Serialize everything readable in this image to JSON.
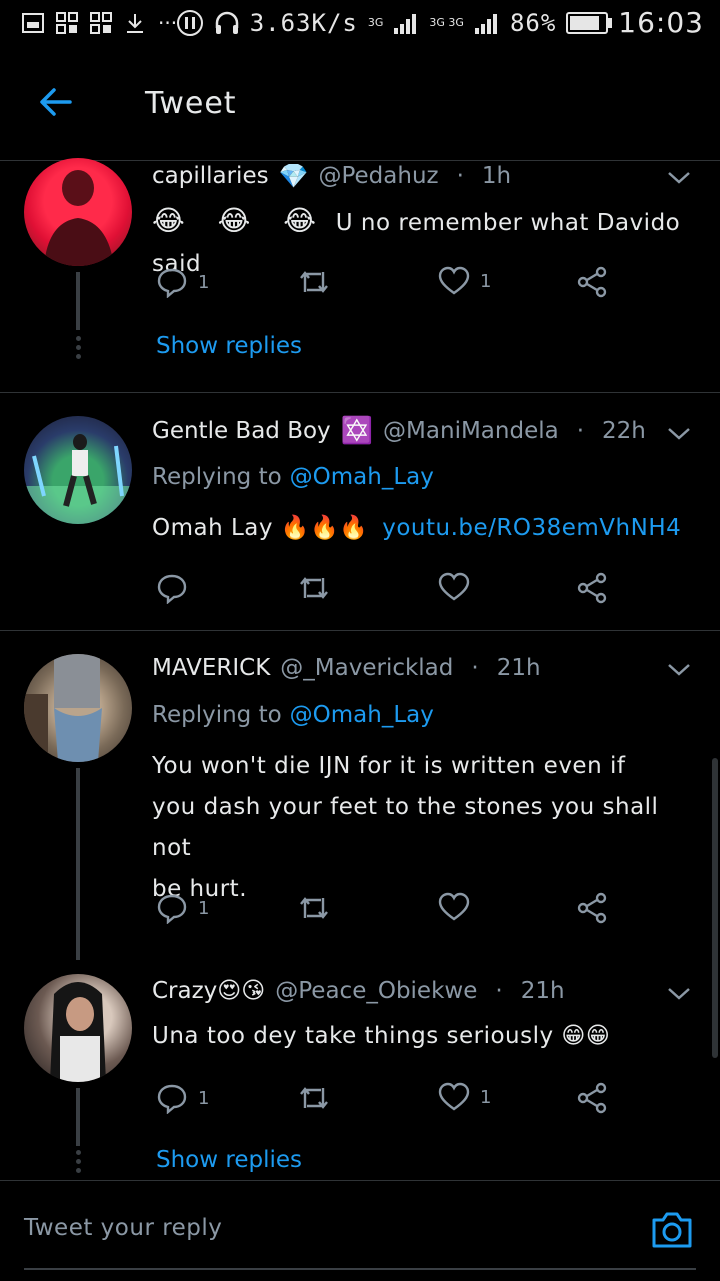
{
  "status_bar": {
    "left_icons": [
      "gallery-icon",
      "app-grid-icon",
      "app-grid-icon",
      "download-icon"
    ],
    "more": "···",
    "net_speed": "3.63K/s",
    "sim1": "3G",
    "sim2": "3G 3G",
    "battery": "86%",
    "battery_level": 0.86,
    "time": "16:03"
  },
  "header": {
    "title": "Tweet"
  },
  "tweets": [
    {
      "name": "capillaries",
      "badge": "💎",
      "handle": "@Pedahuz",
      "time": "1h",
      "replying_to": "",
      "body_emoji": "😂 😂 😂",
      "body": "U no remember what Davido said",
      "reply_count": "1",
      "like_count": "1",
      "show_replies": "Show replies"
    },
    {
      "name": "Gentle Bad Boy",
      "badge": "✡️",
      "handle": "@ManiMandela",
      "time": "22h",
      "replying_label": "Replying to",
      "replying_to": "@Omah_Lay",
      "body": "Omah Lay 🔥🔥🔥",
      "link": "youtu.be/RO38emVhNH4",
      "reply_count": "",
      "like_count": ""
    },
    {
      "name": "MAVERICK",
      "handle": "@_Mavericklad",
      "time": "21h",
      "replying_label": "Replying to",
      "replying_to": "@Omah_Lay",
      "body_lines": [
        "You won't die IJN for it is written even if",
        "you dash your feet to the stones you shall not",
        "be hurt."
      ],
      "reply_count": "1",
      "like_count": ""
    },
    {
      "name": "Crazy😍😘",
      "handle": "@Peace_Obiekwe",
      "time": "21h",
      "body": "Una too dey take things seriously 😁😁",
      "reply_count": "1",
      "like_count": "1",
      "show_replies": "Show replies"
    }
  ],
  "reply_bar": {
    "placeholder": "Tweet your reply"
  },
  "colors": {
    "accent": "#1d9bf0",
    "background": "#000000",
    "secondary_text": "#8b98a5"
  }
}
